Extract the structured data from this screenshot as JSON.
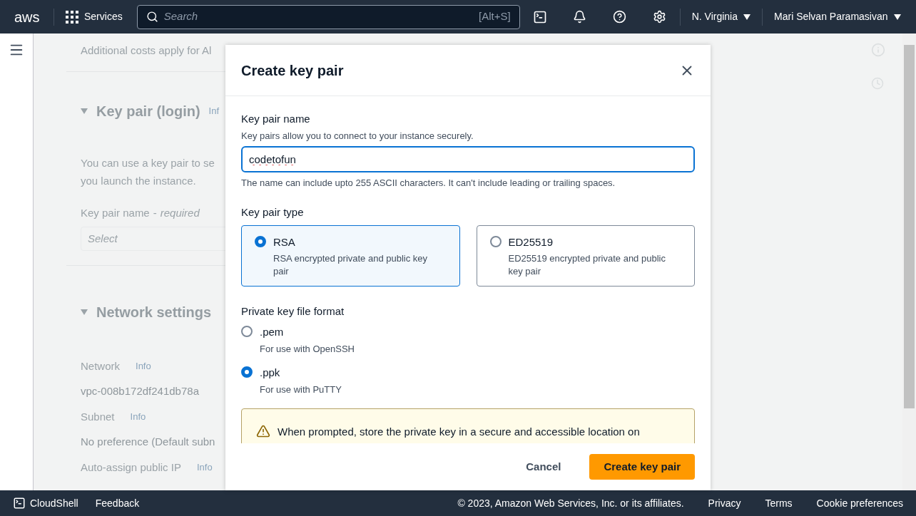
{
  "top_nav": {
    "logo": "aws",
    "services": "Services",
    "search": {
      "placeholder": "Search",
      "shortcut": "[Alt+S]"
    },
    "region": "N. Virginia",
    "user": "Mari Selvan Paramasivan"
  },
  "background": {
    "costs_note": "Additional costs apply for Al",
    "key_pair_section": {
      "title": "Key pair (login)",
      "info": "Inf",
      "description": [
        "You can use a key pair to se",
        "you launch the instance."
      ],
      "field_label": "Key pair name",
      "separator": "-",
      "field_required": "required",
      "select_placeholder": "Select"
    },
    "network_section": {
      "title": "Network settings",
      "fields": [
        {
          "label": "Network",
          "info": "Info",
          "value": "vpc-008b172df241db78a"
        },
        {
          "label": "Subnet",
          "info": "Info",
          "value": "No preference (Default subn"
        },
        {
          "label": "Auto-assign public IP",
          "info": "Info"
        }
      ]
    }
  },
  "modal": {
    "title": "Create key pair",
    "name_field": {
      "label": "Key pair name",
      "description": "Key pairs allow you to connect to your instance securely.",
      "value": "codetofun",
      "constraint": "The name can include upto 255 ASCII characters. It can't include leading or trailing spaces."
    },
    "key_type": {
      "label": "Key pair type",
      "options": [
        {
          "title": "RSA",
          "description": "RSA encrypted private and public key pair",
          "selected": true
        },
        {
          "title": "ED25519",
          "description": "ED25519 encrypted private and public key pair",
          "selected": false
        }
      ]
    },
    "file_format": {
      "label": "Private key file format",
      "options": [
        {
          "title": ".pem",
          "description": "For use with OpenSSH",
          "selected": false
        },
        {
          "title": ".ppk",
          "description": "For use with PuTTY",
          "selected": true
        }
      ]
    },
    "warning": "When prompted, store the private key in a secure and accessible location on",
    "buttons": {
      "cancel": "Cancel",
      "submit": "Create key pair"
    }
  },
  "footer": {
    "cloudshell": "CloudShell",
    "feedback": "Feedback",
    "copyright": "© 2023, Amazon Web Services, Inc. or its affiliates.",
    "links": [
      "Privacy",
      "Terms",
      "Cookie preferences"
    ]
  }
}
